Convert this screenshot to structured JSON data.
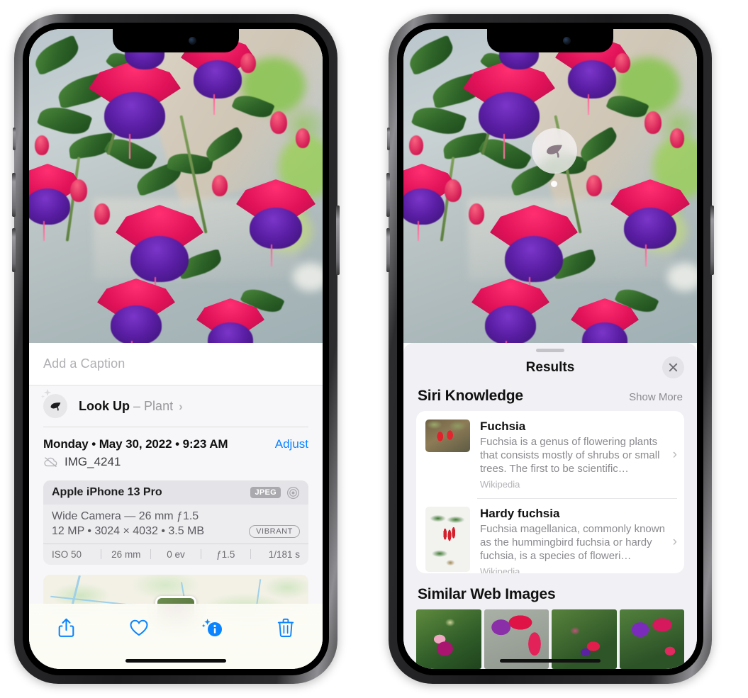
{
  "left_phone": {
    "photo": {
      "alt_name": "fuchsia-flowers-photo"
    },
    "caption_placeholder": "Add a Caption",
    "look_up": {
      "label": "Look Up",
      "dash": "–",
      "subject": "Plant",
      "chevron": "›",
      "icon": "leaf-icon"
    },
    "meta": {
      "date": "Monday • May 30, 2022 • 9:23 AM",
      "adjust_label": "Adjust",
      "filename": "IMG_4241",
      "cloud_icon": "cloud-slash-icon"
    },
    "exif": {
      "model": "Apple iPhone 13 Pro",
      "format_badge": "JPEG",
      "lens_icon": "aperture-icon",
      "lens_line": "Wide Camera — 26 mm ƒ1.5",
      "size_line": "12 MP • 3024 × 4032 • 3.5 MB",
      "style_badge": "VIBRANT",
      "stats": [
        "ISO 50",
        "26 mm",
        "0 ev",
        "ƒ1.5",
        "1/181 s"
      ]
    },
    "toolbar": [
      {
        "name": "share-button",
        "icon": "share-icon"
      },
      {
        "name": "favorite-button",
        "icon": "heart-icon"
      },
      {
        "name": "info-button",
        "icon": "info-sparkle-icon"
      },
      {
        "name": "delete-button",
        "icon": "trash-icon"
      }
    ],
    "accent_color": "#0a84ff"
  },
  "right_phone": {
    "badge": {
      "icon": "leaf-icon",
      "name": "visual-look-up-badge"
    },
    "sheet": {
      "title": "Results",
      "close_icon": "close-icon",
      "siri_knowledge": {
        "heading": "Siri Knowledge",
        "show_more": "Show More",
        "cards": [
          {
            "title": "Fuchsia",
            "description": "Fuchsia is a genus of flowering plants that consists mostly of shrubs or small trees. The first to be scientific…",
            "source": "Wikipedia",
            "thumb": "fuchsia-red-flowers-thumbnail"
          },
          {
            "title": "Hardy fuchsia",
            "description": "Fuchsia magellanica, commonly known as the hummingbird fuchsia or hardy fuchsia, is a species of floweri…",
            "source": "Wikipedia",
            "thumb": "hardy-fuchsia-specimen-thumbnail"
          }
        ]
      },
      "similar_web_images": {
        "heading": "Similar Web Images",
        "images": [
          "fuchsia-pink-purple-web-image",
          "fuchsia-red-closeup-web-image",
          "fuchsia-bush-web-image",
          "fuchsia-purple-cluster-web-image"
        ]
      }
    }
  }
}
